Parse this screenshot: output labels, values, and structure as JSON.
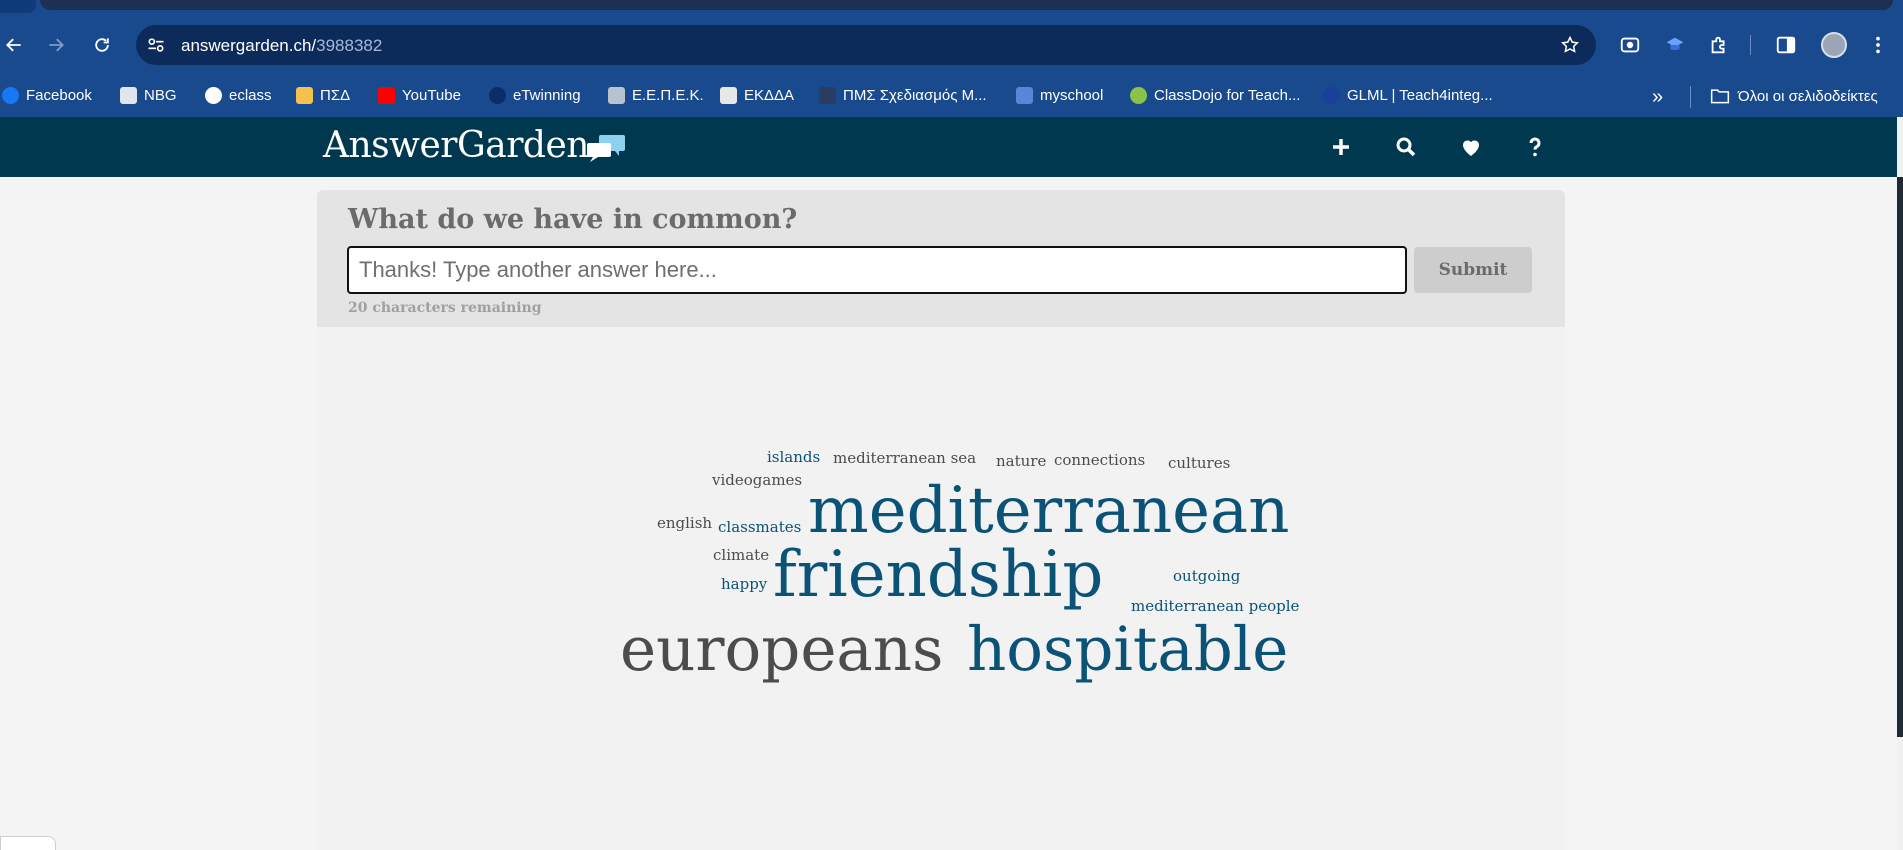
{
  "browser": {
    "url_host": "answergarden.ch/",
    "url_path": "3988382",
    "bookmarks": [
      {
        "label": "Facebook",
        "color": "#1877f2"
      },
      {
        "label": "NBG",
        "color": "#dfe7ee"
      },
      {
        "label": "eclass",
        "color": "#ffffff"
      },
      {
        "label": "ΠΣΔ",
        "color": "#f2c14e"
      },
      {
        "label": "YouTube",
        "color": "#ff0000"
      },
      {
        "label": "eTwinning",
        "color": "#0a2e6b"
      },
      {
        "label": "Ε.Ε.Π.Ε.Κ.",
        "color": "#b9c2cf"
      },
      {
        "label": "ΕΚΔΔΑ",
        "color": "#e7e7e7"
      },
      {
        "label": "ΠΜΣ Σχεδιασμός Μ...",
        "color": "#2b3c63"
      },
      {
        "label": "myschool",
        "color": "#5b86d6"
      },
      {
        "label": "ClassDojo for Teach...",
        "color": "#8bc34a"
      },
      {
        "label": "GLML | Teach4integ...",
        "color": "#1b3f9a"
      }
    ],
    "bookmarks_more": "»",
    "all_bookmarks": "Όλοι οι σελιδοδείκτες"
  },
  "app": {
    "logo": "AnswerGarden",
    "question": "What do we have in common?",
    "input_placeholder": "Thanks! Type another answer here...",
    "submit_label": "Submit",
    "remaining": "20 characters remaining"
  },
  "cloud": {
    "islands": "islands",
    "mediterranean_sea": "mediterranean sea",
    "nature": "nature",
    "connections": "connections",
    "cultures": "cultures",
    "videogames": "videogames",
    "mediterranean": "mediterranean",
    "english": "english",
    "classmates": "classmates",
    "climate": "climate",
    "friendship": "friendship",
    "outgoing": "outgoing",
    "happy": "happy",
    "mediterranean_people": "mediterranean people",
    "europeans": "europeans",
    "hospitable": "hospitable"
  },
  "colors": {
    "header_bg": "#00394f",
    "browser_bg": "#1a4a8e",
    "word_blue": "#0b5277",
    "word_gray": "#4c4c4c"
  }
}
